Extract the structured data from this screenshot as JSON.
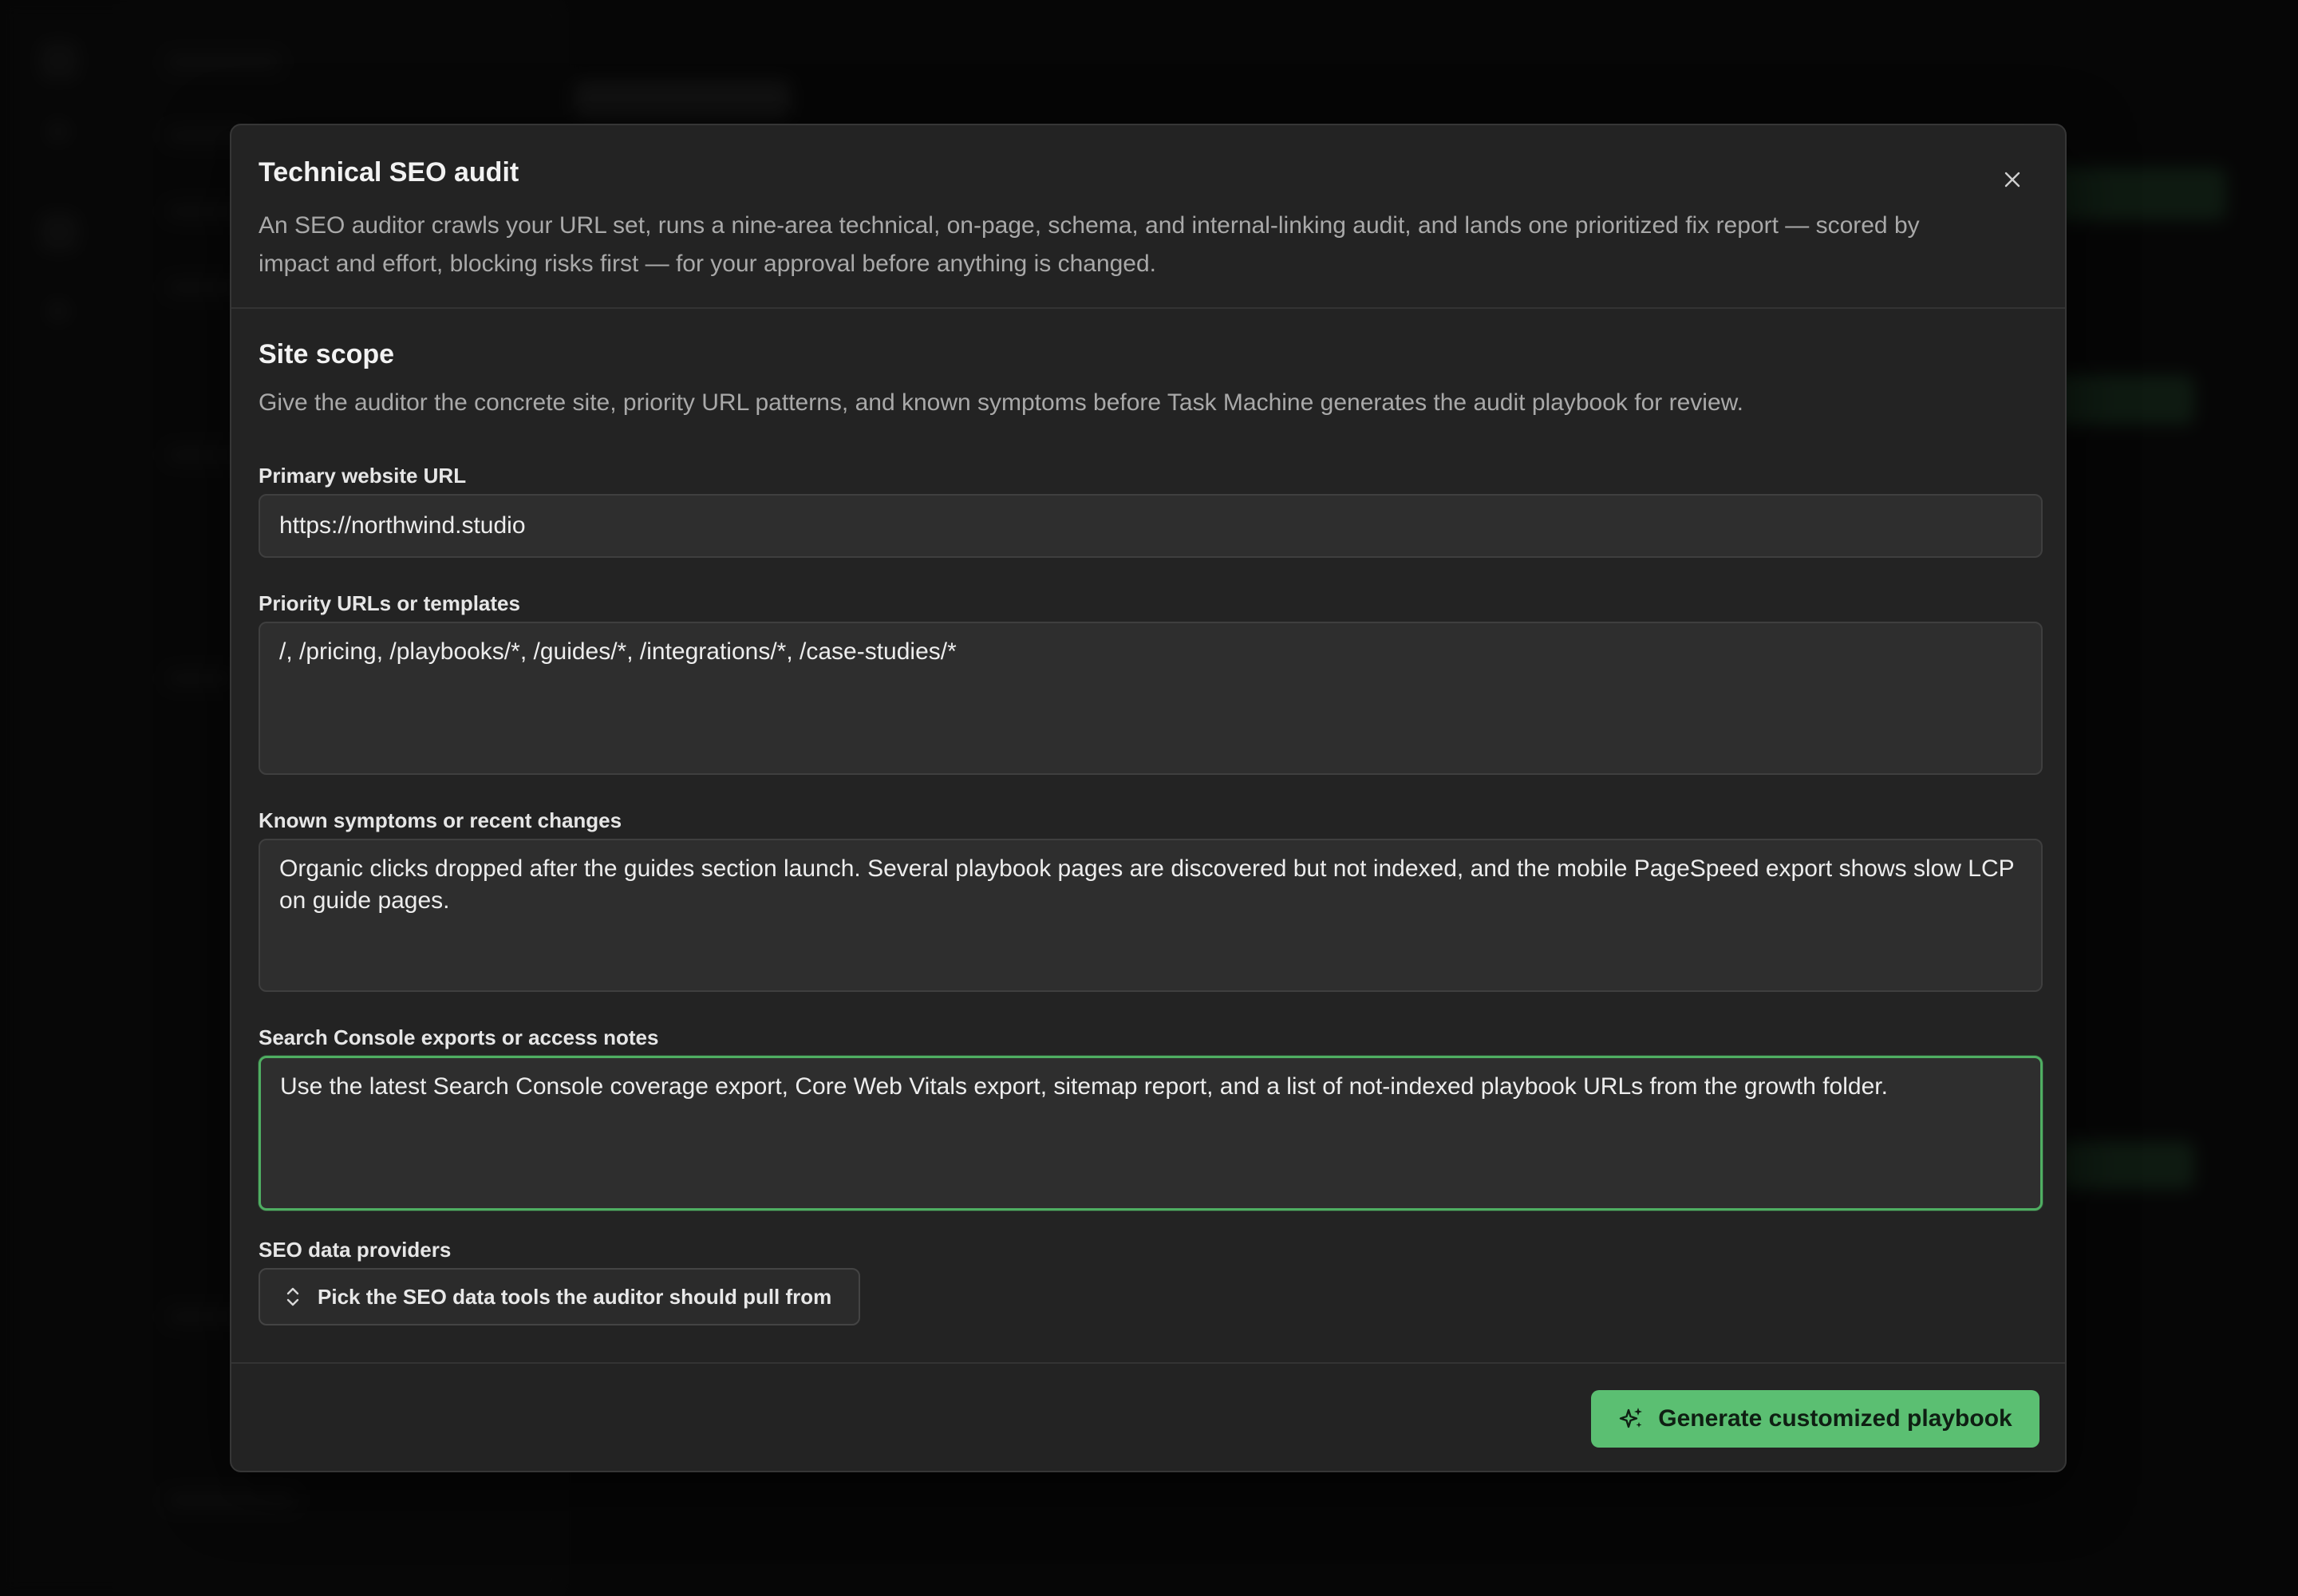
{
  "modal": {
    "title": "Technical SEO audit",
    "description": "An SEO auditor crawls your URL set, runs a nine-area technical, on-page, schema, and internal-linking audit, and lands one prioritized fix report — scored by impact and effort, blocking risks first — for your approval before anything is changed.",
    "close_icon": "close-icon"
  },
  "section": {
    "title": "Site scope",
    "description": "Give the auditor the concrete site, priority URL patterns, and known symptoms before Task Machine generates the audit playbook for review."
  },
  "fields": {
    "primary_url": {
      "label": "Primary website URL",
      "value": "https://northwind.studio"
    },
    "priority_urls": {
      "label": "Priority URLs or templates",
      "value": "/, /pricing, /playbooks/*, /guides/*, /integrations/*, /case-studies/*"
    },
    "symptoms": {
      "label": "Known symptoms or recent changes",
      "value": "Organic clicks dropped after the guides section launch. Several playbook pages are discovered but not indexed, and the mobile PageSpeed export shows slow LCP on guide pages."
    },
    "search_console": {
      "label": "Search Console exports or access notes",
      "value": "Use the latest Search Console coverage export, Core Web Vitals export, sitemap report, and a list of not-indexed playbook URLs from the growth folder."
    },
    "providers": {
      "label": "SEO data providers",
      "button_label": "Pick the SEO data tools the auditor should pull from",
      "icon": "chevron-up-down-icon"
    }
  },
  "footer": {
    "primary_label": "Generate customized playbook",
    "primary_icon": "sparkles-icon"
  },
  "colors": {
    "accent": "#5bbf72",
    "focus_border": "#4fae62",
    "modal_bg": "#232323"
  }
}
